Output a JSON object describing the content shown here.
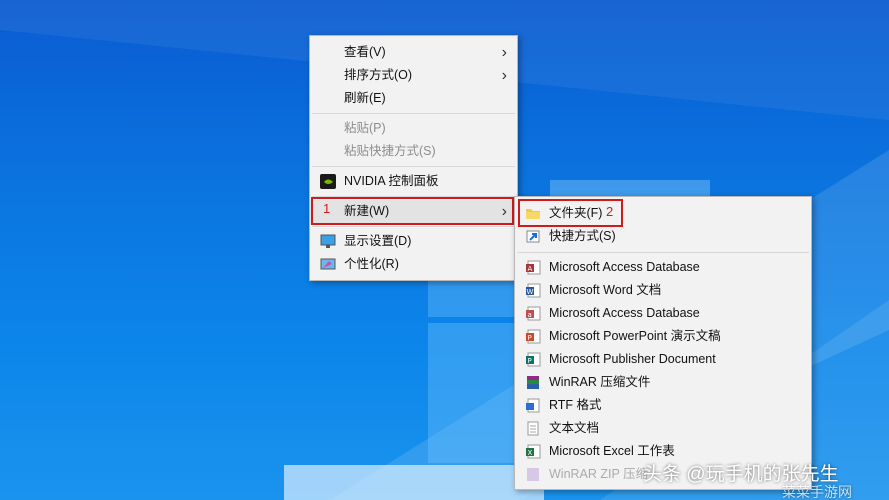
{
  "context_menu": {
    "items": [
      {
        "label": "查看(V)"
      },
      {
        "label": "排序方式(O)"
      },
      {
        "label": "刷新(E)"
      },
      {
        "label": "粘贴(P)"
      },
      {
        "label": "粘贴快捷方式(S)"
      },
      {
        "label": "NVIDIA 控制面板"
      },
      {
        "label": "新建(W)"
      },
      {
        "label": "显示设置(D)"
      },
      {
        "label": "个性化(R)"
      }
    ]
  },
  "submenu": {
    "items": [
      {
        "label": "文件夹(F)"
      },
      {
        "label": "快捷方式(S)"
      },
      {
        "label": "Microsoft Access Database"
      },
      {
        "label": "Microsoft Word 文档"
      },
      {
        "label": "Microsoft Access Database"
      },
      {
        "label": "Microsoft PowerPoint 演示文稿"
      },
      {
        "label": "Microsoft Publisher Document"
      },
      {
        "label": "WinRAR 压缩文件"
      },
      {
        "label": "RTF 格式"
      },
      {
        "label": "文本文档"
      },
      {
        "label": "Microsoft Excel 工作表"
      },
      {
        "label": "WinRAR ZIP 压缩"
      }
    ]
  },
  "annotations": {
    "marker1": "1",
    "marker2": "2"
  },
  "watermark": {
    "text": "头条 @玩手机的张先生",
    "site": "菜菜手游网"
  },
  "colors": {
    "highlight": "#d11a1a",
    "desktop": "#0b76e0",
    "menu_bg": "#f2f2f2"
  }
}
